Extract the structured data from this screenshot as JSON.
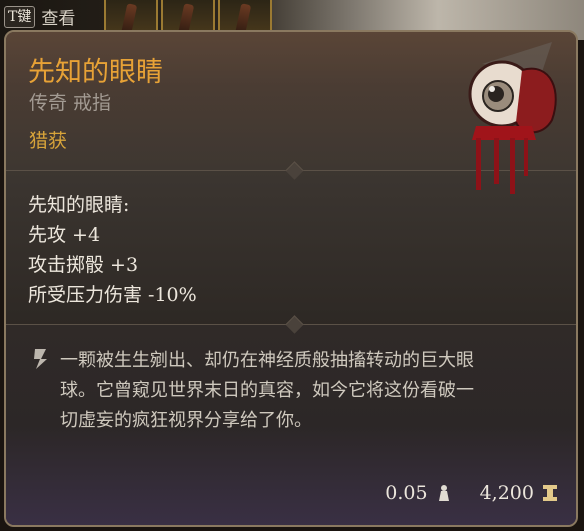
{
  "hotbar": {
    "key_label": "T键",
    "inspect_label": "查看",
    "slot_icons": [
      "staff-icon",
      "staff-icon",
      "staff-icon"
    ]
  },
  "item": {
    "name": "先知的眼睛",
    "subtitle": "传奇 戒指",
    "tag": "猎获",
    "icon": "bloody-eyeball-icon",
    "stats_header": "先知的眼睛:",
    "stats": [
      "先攻 +4",
      "攻击掷骰 +3",
      "所受压力伤害 -10%"
    ],
    "flavor_lines": [
      "一颗被生生剜出、却仍在神经质般抽搐转动的巨大眼",
      "球。它曾窥见世界末日的真容，如今它将这份看破一",
      "切虚妄的疯狂视界分享给了你。"
    ],
    "flavor_icon": "quill-icon",
    "weight": "0.05",
    "weight_icon": "weight-icon",
    "value": "4,200",
    "value_icon": "gold-icon"
  },
  "colors": {
    "title": "#e7a236",
    "tag": "#d8a43a",
    "border": "#8a7960"
  }
}
